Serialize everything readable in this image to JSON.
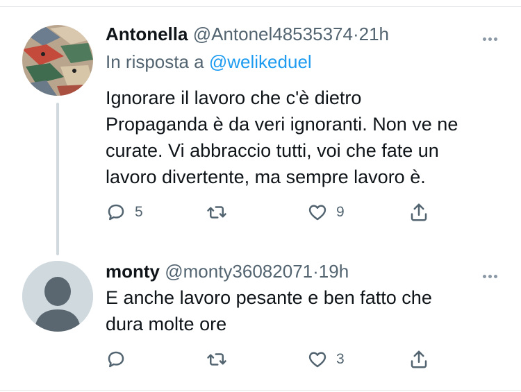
{
  "tweets": [
    {
      "name": "Antonella",
      "handle": "@Antonel48535374",
      "separator": "·",
      "time": "21h",
      "reply_prefix": "In risposta a",
      "reply_mention": "@welikeduel",
      "lines": [
        "Ignorare il lavoro che c'è dietro",
        "Propaganda è  da veri ignoranti. Non ve ne",
        "curate. Vi abbraccio tutti, voi che fate un",
        "lavoro divertente, ma sempre lavoro è."
      ],
      "reply_count": "5",
      "retweet_count": "",
      "like_count": "9"
    },
    {
      "name": "monty",
      "handle": "@monty36082071",
      "separator": "·",
      "time": "19h",
      "lines": [
        "E anche lavoro pesante e ben fatto che",
        "dura molte ore"
      ],
      "reply_count": "",
      "retweet_count": "",
      "like_count": "3"
    }
  ],
  "icons": {
    "reply": "reply-icon",
    "retweet": "retweet-icon",
    "like": "heart-icon",
    "share": "share-icon",
    "more": "more-icon"
  },
  "colors": {
    "text": "#0f1419",
    "secondary": "#536471",
    "mention": "#1d9bf0",
    "thread_line": "#cfd9de"
  }
}
